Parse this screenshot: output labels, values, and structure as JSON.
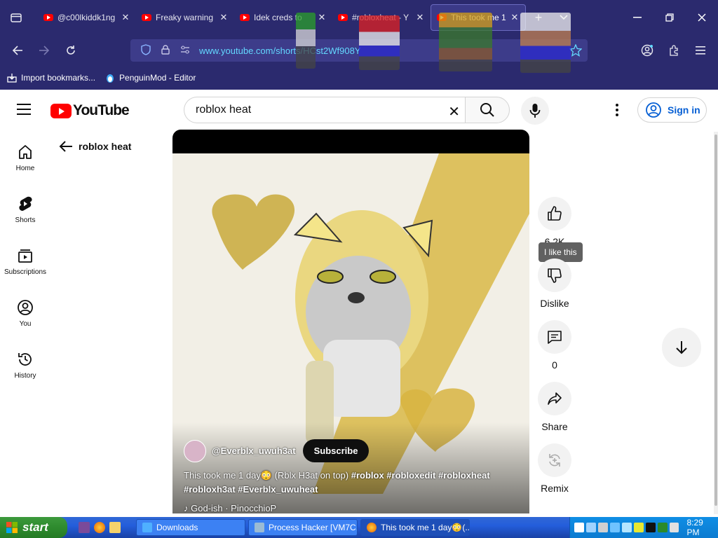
{
  "browser": {
    "tabs": [
      {
        "label": "@c00lkiddk1ng",
        "active": false
      },
      {
        "label": "Freaky warning",
        "active": false
      },
      {
        "label": "Idek creds to",
        "active": false
      },
      {
        "label": "#robloxheat - Y",
        "active": false
      },
      {
        "label": "This took me 1",
        "active": true
      }
    ],
    "tab_close_glyph": "✕",
    "url": "www.youtube.com/shorts/HCst2Wf908Y",
    "bookmarks": [
      {
        "label": "Import bookmarks...",
        "icon": "import-icon"
      },
      {
        "label": "PenguinMod - Editor",
        "icon": "penguinmod-icon"
      }
    ]
  },
  "youtube": {
    "logo_text": "YouTube",
    "search": {
      "value": "roblox heat",
      "clear_glyph": "✕"
    },
    "signin_label": "Sign in",
    "rail": [
      {
        "label": "Home",
        "icon": "home-icon"
      },
      {
        "label": "Shorts",
        "icon": "shorts-icon"
      },
      {
        "label": "Subscriptions",
        "icon": "subscriptions-icon"
      },
      {
        "label": "You",
        "icon": "you-icon"
      },
      {
        "label": "History",
        "icon": "history-icon"
      }
    ],
    "back_label": "roblox heat",
    "video": {
      "channel": "@Everblx_uwuh3at",
      "subscribe_label": "Subscribe",
      "caption_prefix": "This took me 1 day",
      "caption_emoji": "😳",
      "caption_mid": " (Rblx H3at on top) ",
      "hashtags": "#roblox #robloxedit #robloxheat #robloxh3at #Everblx_uwuheat",
      "music": "♪ God-ish · PinocchioP"
    },
    "actions": {
      "like_count": "6.2K",
      "like_tooltip": "I like this",
      "dislike_label": "Dislike",
      "comments_count": "0",
      "share_label": "Share",
      "remix_label": "Remix"
    }
  },
  "taskbar": {
    "start_label": "start",
    "tasks": [
      {
        "label": "Downloads",
        "active": false
      },
      {
        "label": "Process Hacker [VM7C...",
        "active": false
      },
      {
        "label": "This took me 1 day😳(...",
        "active": true
      }
    ],
    "clock": "8:29 PM"
  },
  "colors": {
    "browser_chrome": "#2b2a6e",
    "url_text": "#63d8ff",
    "youtube_red": "#ff0000",
    "signin_blue": "#065fd4",
    "taskbar_blue": "#245edb",
    "start_green": "#2e8b2e"
  }
}
